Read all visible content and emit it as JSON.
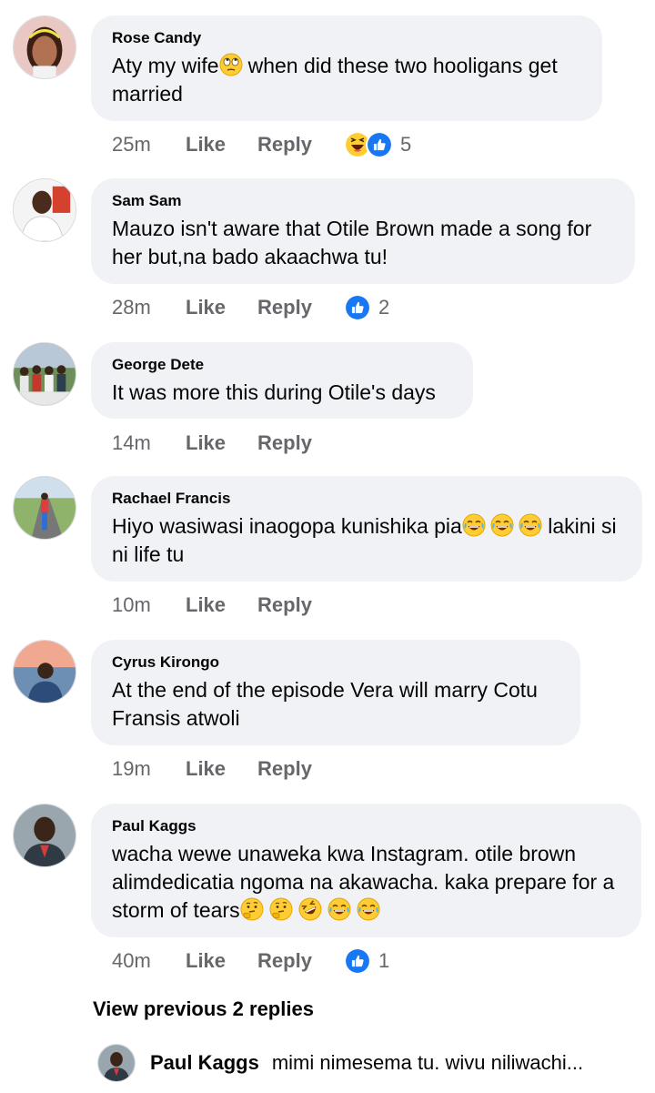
{
  "labels": {
    "like": "Like",
    "reply": "Reply"
  },
  "comments": [
    {
      "author": "Rose Candy",
      "text_a": "Aty my wife",
      "text_b": "when did these two hooligans get married",
      "time": "25m",
      "reactions": [
        "haha",
        "like"
      ],
      "reaction_count": "5",
      "avatar": "woman-avatar"
    },
    {
      "author": "Sam Sam",
      "text": "Mauzo isn't aware that Otile Brown made a song for her but,na bado akaachwa tu!",
      "time": "28m",
      "reactions": [
        "like"
      ],
      "reaction_count": "2",
      "avatar": "man-white-shirt-avatar"
    },
    {
      "author": "George Dete",
      "text": "It was more this during Otile's days",
      "time": "14m",
      "avatar": "group-photo-avatar"
    },
    {
      "author": "Rachael Francis",
      "text_a": "Hiyo wasiwasi inaogopa kunishika pia",
      "text_b": " lakini si ni life tu",
      "time": "10m",
      "avatar": "road-avatar"
    },
    {
      "author": "Cyrus Kirongo",
      "text": "At the end of the episode Vera will marry Cotu Fransis atwoli",
      "time": "19m",
      "avatar": "sunset-man-avatar"
    },
    {
      "author": "Paul Kaggs",
      "text": "wacha wewe unaweka kwa Instagram.  otile brown alimdedicatia ngoma na akawacha. kaka prepare for a storm of tears",
      "time": "40m",
      "reactions": [
        "like"
      ],
      "reaction_count": "1",
      "avatar": "man-red-avatar"
    }
  ],
  "view_previous": "View previous 2 replies",
  "reply": {
    "author": "Paul Kaggs",
    "text": "mimi nimesema tu. wivu niliwachi..."
  },
  "colors": {
    "bubble": "#f0f2f5",
    "meta": "#65676b",
    "like_blue": "#1877f2",
    "emoji_yellow": "#ffcc33"
  }
}
